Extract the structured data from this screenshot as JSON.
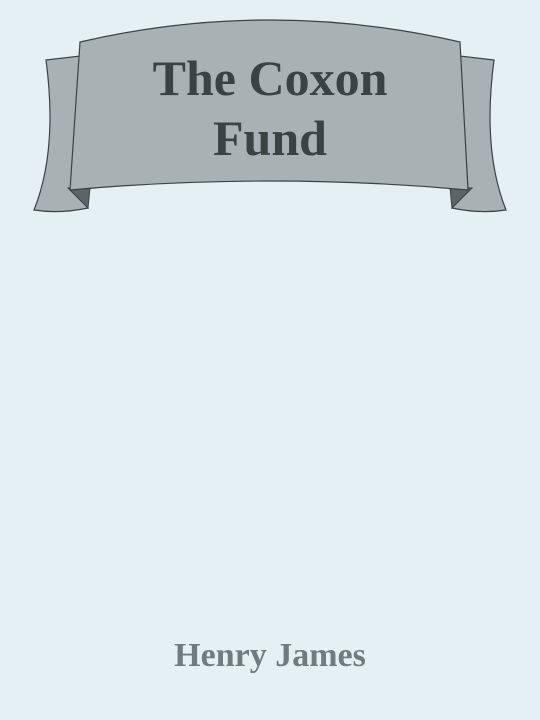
{
  "book": {
    "title_lines": [
      "The Coxon",
      "Fund"
    ],
    "author": "Henry James"
  },
  "colors": {
    "background": "#e4f0f4",
    "banner_fill": "#a8b2b4",
    "banner_fold": "#5c6466",
    "banner_outline": "#3b4244",
    "title_text": "#3b4244",
    "author_text": "#6f7b7d"
  }
}
